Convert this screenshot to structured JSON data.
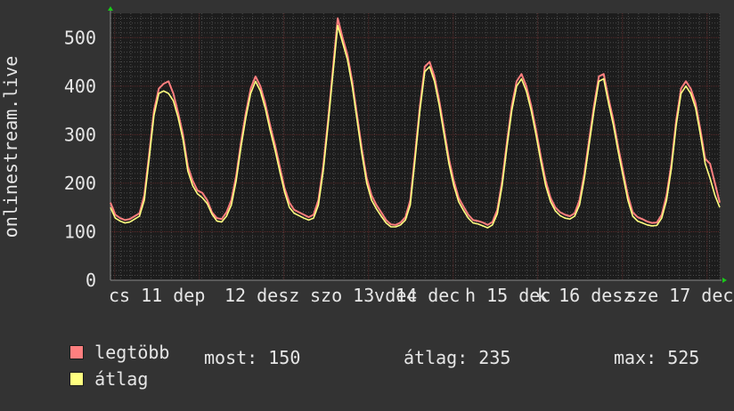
{
  "chart_data": {
    "type": "line",
    "ylabel": "onlinestream.live",
    "ylim": [
      0,
      550
    ],
    "y_ticks": [
      0,
      100,
      200,
      300,
      400,
      500
    ],
    "x_ticks": [
      "cs 11 dep",
      "12 desz",
      "szo 13 dec",
      "v 14 dec",
      "h 15 dec",
      "k 16 desz",
      "sze 17 dec"
    ],
    "grid": true,
    "colors": {
      "background": "#333333",
      "plot_bg": "#1c1c1c",
      "grid": "#4a4a4a",
      "grid_major": "#5a2a2a",
      "axis_marker": "#19c819"
    },
    "series": [
      {
        "name": "legtöbb",
        "color": "#ff7f7f",
        "values": [
          160,
          135,
          128,
          124,
          126,
          132,
          138,
          175,
          260,
          350,
          395,
          405,
          410,
          385,
          345,
          300,
          235,
          205,
          185,
          180,
          165,
          140,
          128,
          126,
          140,
          165,
          215,
          285,
          345,
          395,
          420,
          400,
          365,
          320,
          280,
          235,
          190,
          160,
          145,
          140,
          135,
          130,
          135,
          165,
          235,
          330,
          435,
          540,
          500,
          465,
          410,
          340,
          270,
          210,
          175,
          155,
          140,
          124,
          115,
          114,
          119,
          130,
          165,
          260,
          360,
          440,
          450,
          420,
          370,
          310,
          250,
          205,
          170,
          152,
          135,
          124,
          122,
          119,
          114,
          120,
          145,
          205,
          285,
          360,
          410,
          425,
          400,
          360,
          310,
          255,
          205,
          170,
          150,
          140,
          135,
          132,
          138,
          165,
          220,
          290,
          360,
          420,
          425,
          375,
          330,
          275,
          225,
          175,
          140,
          130,
          126,
          121,
          118,
          119,
          135,
          175,
          240,
          330,
          395,
          410,
          395,
          365,
          310,
          250,
          240,
          200,
          160
        ]
      },
      {
        "name": "átlag",
        "color": "#ffff80",
        "values": [
          150,
          128,
          122,
          118,
          120,
          126,
          132,
          165,
          250,
          340,
          385,
          390,
          385,
          370,
          335,
          290,
          225,
          195,
          178,
          170,
          158,
          136,
          122,
          120,
          132,
          155,
          205,
          275,
          335,
          385,
          410,
          390,
          355,
          310,
          270,
          225,
          182,
          150,
          138,
          133,
          128,
          124,
          128,
          155,
          225,
          320,
          425,
          525,
          490,
          455,
          400,
          330,
          260,
          200,
          165,
          147,
          132,
          118,
          110,
          110,
          114,
          124,
          155,
          250,
          350,
          430,
          440,
          410,
          360,
          300,
          240,
          195,
          162,
          144,
          128,
          118,
          116,
          112,
          108,
          114,
          137,
          195,
          275,
          350,
          400,
          415,
          390,
          350,
          300,
          245,
          195,
          162,
          143,
          133,
          128,
          126,
          132,
          155,
          210,
          280,
          350,
          410,
          415,
          365,
          320,
          265,
          215,
          165,
          132,
          122,
          118,
          114,
          112,
          113,
          128,
          165,
          230,
          320,
          385,
          400,
          385,
          355,
          300,
          240,
          210,
          175,
          150
        ]
      }
    ],
    "legend": [
      {
        "label": "legtöbb",
        "color": "#ff7f7f"
      },
      {
        "label": "átlag",
        "color": "#ffff80"
      }
    ],
    "stats": {
      "most": "most: 150",
      "atlag": "átlag: 235",
      "max": "max: 525"
    }
  }
}
